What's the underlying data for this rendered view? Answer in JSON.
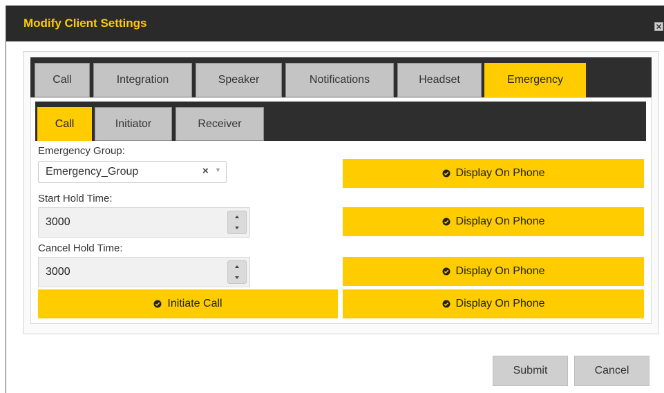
{
  "dialog": {
    "title": "Modify Client Settings",
    "close_icon": "close-icon"
  },
  "outer_tabs": [
    {
      "label": "Call",
      "active": false
    },
    {
      "label": "Integration",
      "active": false
    },
    {
      "label": "Speaker",
      "active": false
    },
    {
      "label": "Notifications",
      "active": false
    },
    {
      "label": "Headset",
      "active": false
    },
    {
      "label": "Emergency",
      "active": true
    }
  ],
  "inner_tabs": [
    {
      "label": "Call",
      "active": true
    },
    {
      "label": "Initiator",
      "active": false
    },
    {
      "label": "Receiver",
      "active": false
    }
  ],
  "form": {
    "emergency_group_label": "Emergency Group:",
    "emergency_group_value": "Emergency_Group",
    "emergency_group_clear": "×",
    "emergency_group_arrow": "▼",
    "start_hold_label": "Start Hold Time:",
    "start_hold_value": "3000",
    "cancel_hold_label": "Cancel Hold Time:",
    "cancel_hold_value": "3000",
    "initiate_call_label": "Initiate Call",
    "display_on_phone_label": "Display On Phone"
  },
  "footer": {
    "submit_label": "Submit",
    "cancel_label": "Cancel"
  },
  "colors": {
    "accent": "#ffcc00",
    "titlebar": "#2a2a2a",
    "tab_inactive": "#c4c4c4"
  }
}
